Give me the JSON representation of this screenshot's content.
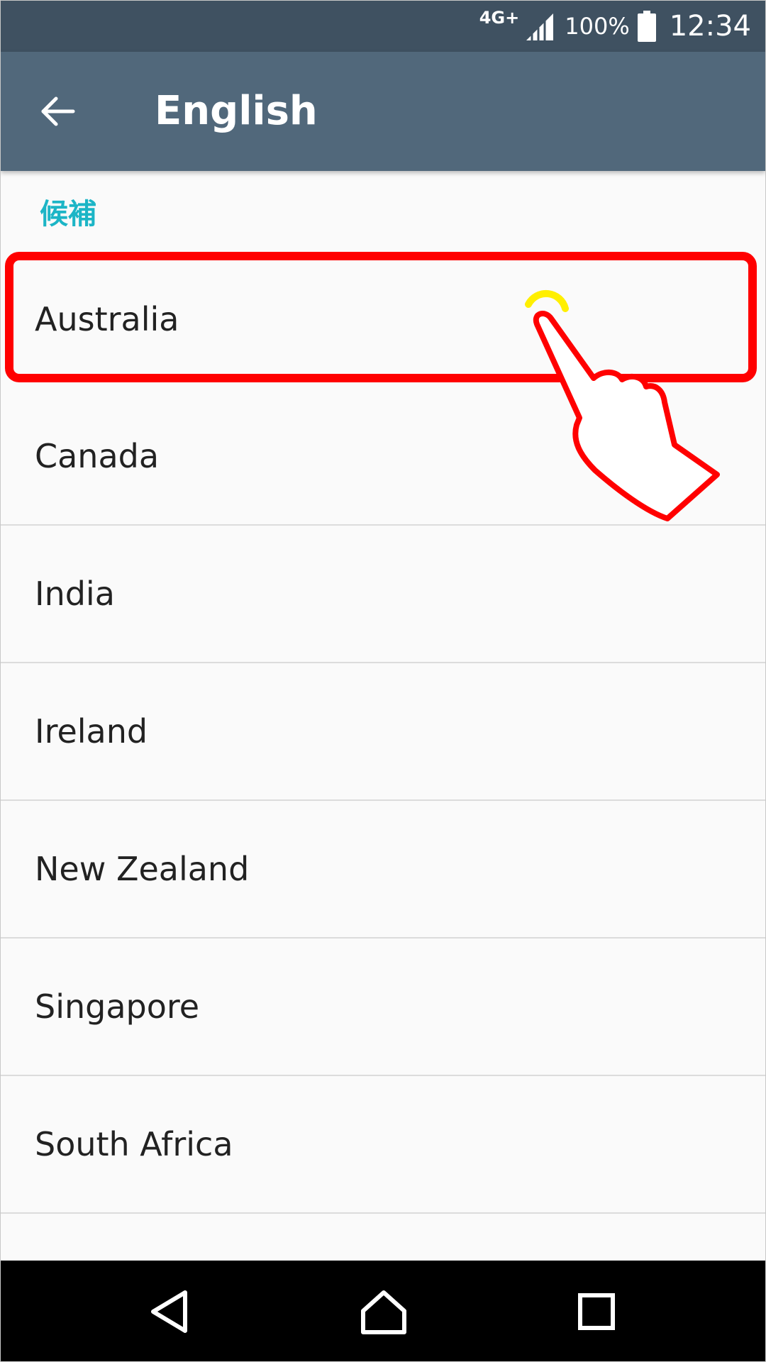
{
  "status_bar": {
    "network": "4G+",
    "battery_percent": "100%",
    "time": "12:34",
    "signal_icon": "signal-icon",
    "battery_icon": "battery-icon"
  },
  "app_bar": {
    "back_icon": "arrow-left-icon",
    "title": "English",
    "background_color": "#51687b"
  },
  "section": {
    "header": "候補",
    "header_color": "#1cb5c6"
  },
  "list": {
    "items": [
      {
        "label": "Australia",
        "highlighted": true
      },
      {
        "label": "Canada"
      },
      {
        "label": "India"
      },
      {
        "label": "Ireland"
      },
      {
        "label": "New Zealand"
      },
      {
        "label": "Singapore"
      },
      {
        "label": "South Africa"
      }
    ]
  },
  "annotation": {
    "highlight_color": "#ff0000",
    "pointer_icon": "hand-pointer-icon"
  },
  "nav_bar": {
    "back_icon": "triangle-back-icon",
    "home_icon": "home-icon",
    "recents_icon": "square-recents-icon"
  }
}
